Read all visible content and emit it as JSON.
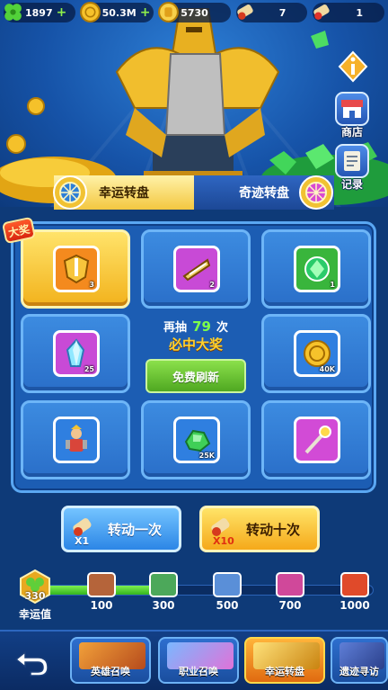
{
  "resources": [
    {
      "icon": "clover-icon",
      "value": "1897",
      "plus": "+"
    },
    {
      "icon": "gold-coin-icon",
      "value": "50.3M",
      "plus": "+"
    },
    {
      "icon": "coin-stack-icon",
      "value": "5730",
      "plus": ""
    },
    {
      "icon": "lucky-scroll-icon",
      "value": "7",
      "plus": ""
    },
    {
      "icon": "ticket-scroll-icon",
      "value": "1",
      "plus": ""
    }
  ],
  "side": {
    "shop_label": "商店",
    "record_label": "记录"
  },
  "tabs": {
    "lucky": "幸运转盘",
    "miracle": "奇迹转盘"
  },
  "big_prize_label": "大奖",
  "wheel": {
    "items": [
      {
        "icon": "sword-shield-icon",
        "qty": "3",
        "color": "#f48a1e"
      },
      {
        "icon": "blade-scroll-icon",
        "qty": "2",
        "color": "#c84ad6"
      },
      {
        "icon": "green-gem-icon",
        "qty": "1",
        "color": "#39b53c"
      },
      {
        "icon": "crystal-icon",
        "qty": "25",
        "color": "#c84ad6"
      },
      {
        "icon": "gold-coin-icon",
        "qty": "40K",
        "color": "#2f7fe0"
      },
      {
        "icon": "hero-icon",
        "qty": "",
        "color": "#2f7fe0"
      },
      {
        "icon": "green-ore-icon",
        "qty": "25K",
        "color": "#2f7fe0"
      },
      {
        "icon": "magic-wand-icon",
        "qty": "",
        "color": "#d24bd6"
      }
    ],
    "center": {
      "prefix": "再抽",
      "count": "79",
      "suffix": "次",
      "guarantee": "必中大奖",
      "refresh": "免费刷新"
    }
  },
  "spin": {
    "once_label": "转动一次",
    "once_mult": "X1",
    "ten_label": "转动十次",
    "ten_mult": "X10"
  },
  "luck": {
    "value": "330",
    "label": "幸运值",
    "progress": 0.33
  },
  "milestones": [
    {
      "value": "100",
      "color": "#b5643a"
    },
    {
      "value": "300",
      "color": "#4ca85a"
    },
    {
      "value": "500",
      "color": "#5a8fd8"
    },
    {
      "value": "700",
      "color": "#d0489a"
    },
    {
      "value": "1000",
      "color": "#e04a2a"
    }
  ],
  "nav": {
    "hero_summon": "英雄召唤",
    "class_summon": "职业召唤",
    "lucky_wheel": "幸运转盘",
    "relic_search": "遗迹寻访"
  }
}
